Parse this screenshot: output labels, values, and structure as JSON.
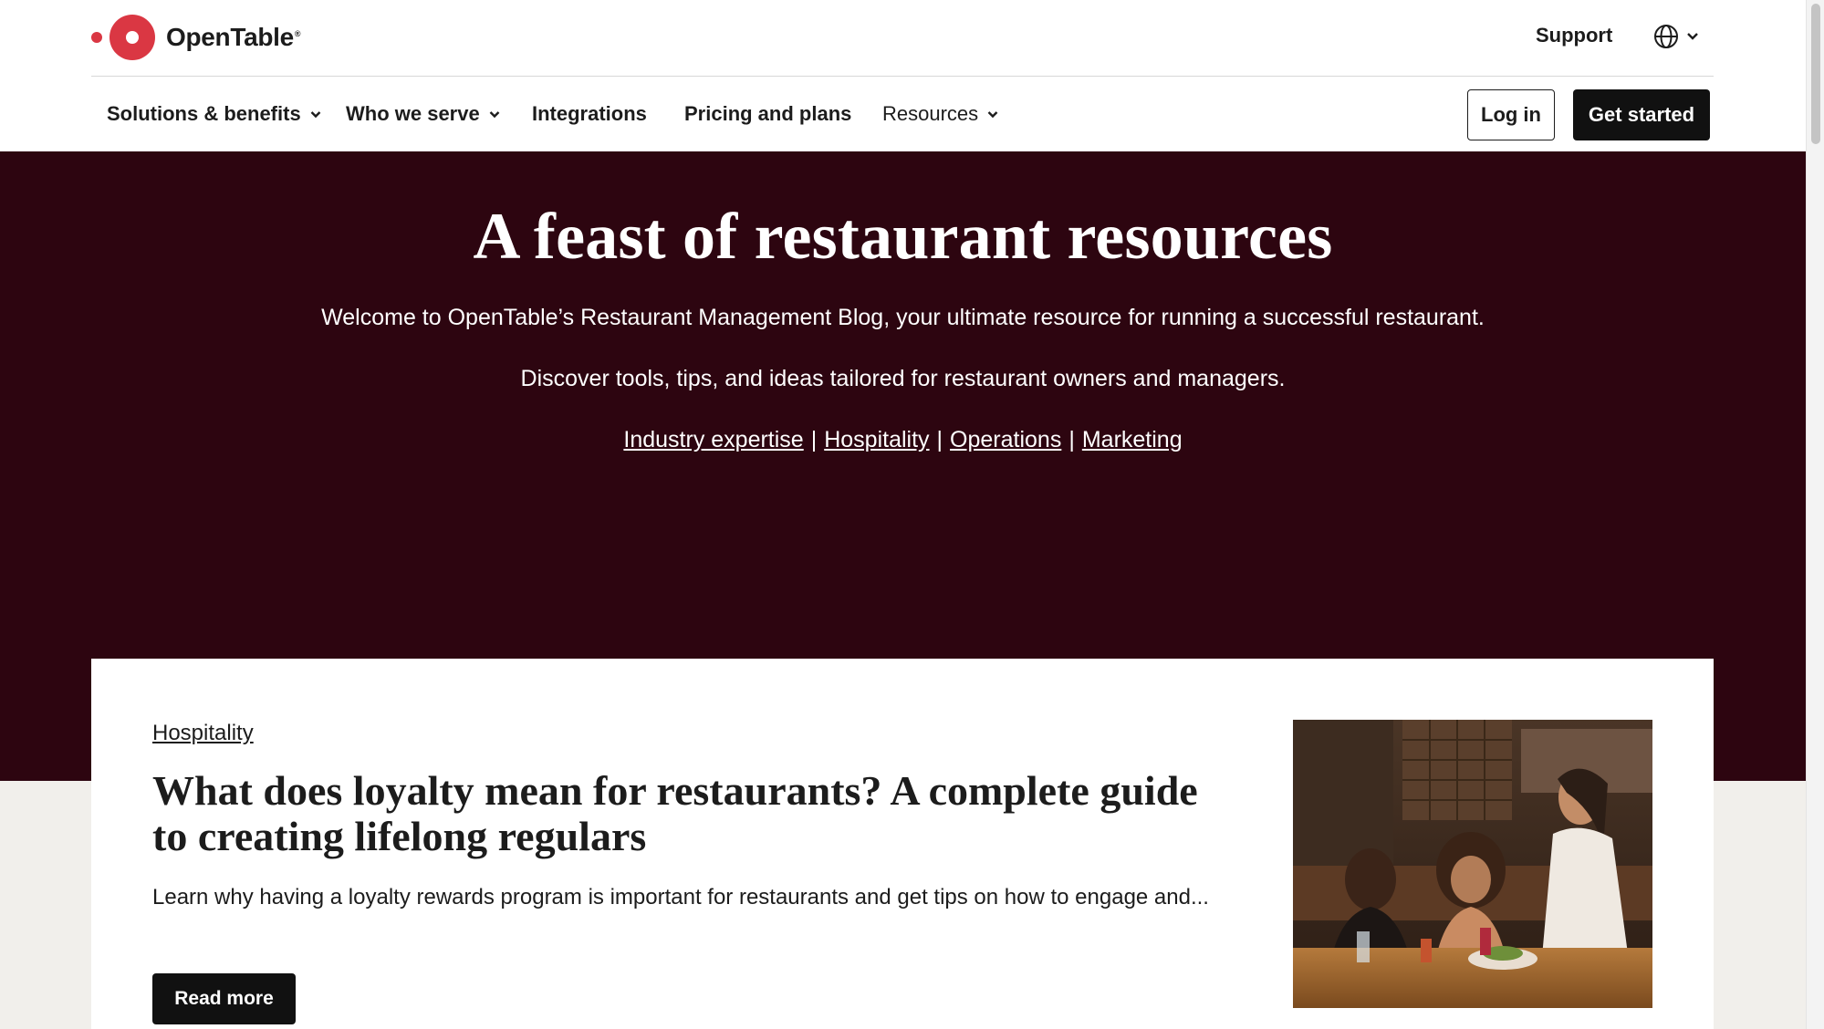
{
  "brand": {
    "name": "OpenTable",
    "registered_mark": "®",
    "accent_color": "#da3743",
    "hero_color": "#2d0510"
  },
  "header": {
    "support_label": "Support",
    "language_icon": "globe-icon"
  },
  "nav": {
    "items": [
      {
        "label": "Solutions & benefits",
        "has_dropdown": true
      },
      {
        "label": "Who we serve",
        "has_dropdown": true
      },
      {
        "label": "Integrations",
        "has_dropdown": false
      },
      {
        "label": "Pricing and plans",
        "has_dropdown": false
      },
      {
        "label": "Resources",
        "has_dropdown": true
      }
    ],
    "login_label": "Log in",
    "get_started_label": "Get started"
  },
  "hero": {
    "title": "A feast of restaurant resources",
    "intro": "Welcome to OpenTable’s Restaurant Management Blog, your ultimate resource for running a successful restaurant.",
    "subintro": "Discover tools, tips, and ideas tailored for restaurant owners and managers.",
    "links": [
      "Industry expertise",
      "Hospitality",
      "Operations",
      "Marketing"
    ],
    "separator": "|"
  },
  "featured": {
    "category": "Hospitality",
    "title": "What does loyalty mean for restaurants? A complete guide to creating lifelong regulars",
    "description": "Learn why having a loyalty rewards program is important for restaurants and get tips on how to engage and...",
    "read_more_label": "Read more",
    "image_alt": "Three women smiling at a restaurant table while a server brings a dish"
  }
}
